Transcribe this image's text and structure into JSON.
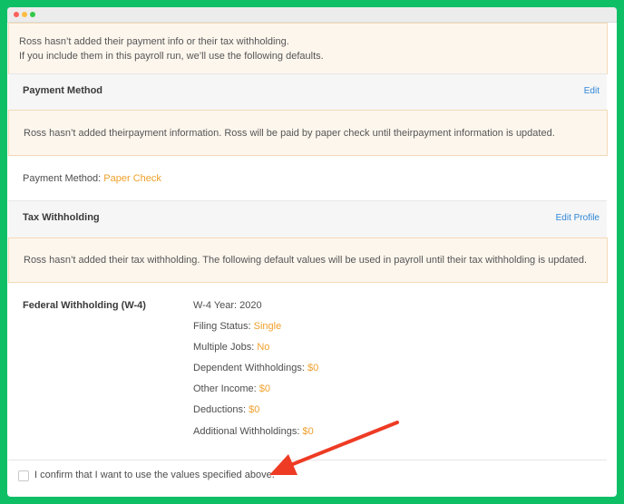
{
  "banner": {
    "line1": "Ross hasn’t added their payment info or their tax withholding.",
    "line2": "If you include them in this payroll run, we’ll use the following defaults."
  },
  "payment_method": {
    "title": "Payment Method",
    "edit_label": "Edit",
    "notice": "Ross hasn’t added theirpayment information. Ross will be paid by paper check until theirpayment information is updated.",
    "label": "Payment Method:",
    "value": "Paper Check"
  },
  "tax_withholding": {
    "title": "Tax Withholding",
    "edit_label": "Edit Profile",
    "notice": "Ross hasn’t added their tax withholding. The following default values will be used in payroll until their tax withholding is updated.",
    "federal_title": "Federal Withholding (W-4)",
    "fields": [
      {
        "label": "W-4 Year:",
        "value": "2020"
      },
      {
        "label": "Filing Status:",
        "value": "Single"
      },
      {
        "label": "Multiple Jobs:",
        "value": "No"
      },
      {
        "label": "Dependent Withholdings:",
        "value": "$0"
      },
      {
        "label": "Other Income:",
        "value": "$0"
      },
      {
        "label": "Deductions:",
        "value": "$0"
      },
      {
        "label": "Additional Withholdings:",
        "value": "$0"
      }
    ]
  },
  "confirm": {
    "label": "I confirm that I want to use the values specified above."
  },
  "colors": {
    "background": "#0fbf66",
    "accent_link": "#2f86d6",
    "value_orange": "#f0a02c",
    "arrow_red": "#ee3b24"
  }
}
